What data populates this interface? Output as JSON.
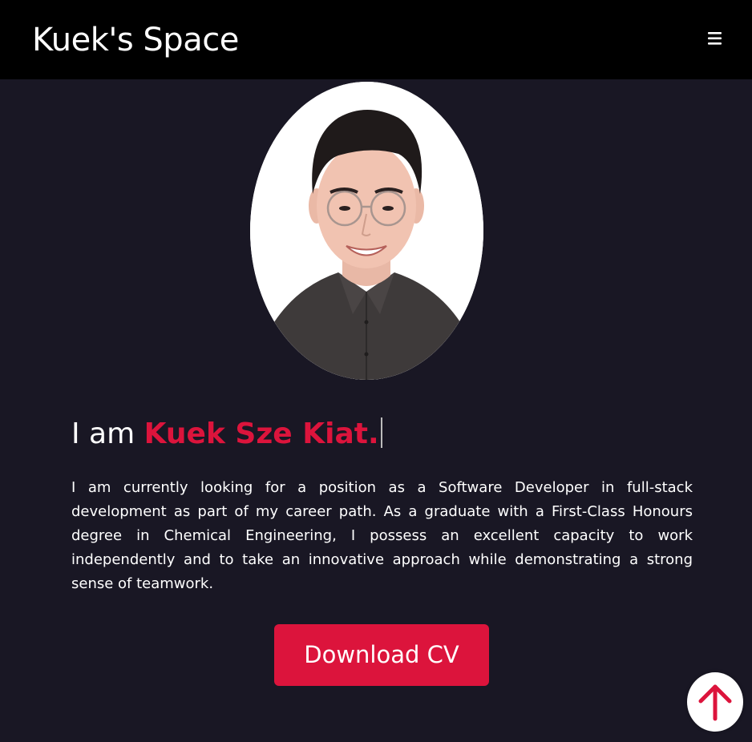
{
  "navbar": {
    "brand": "Kuek's Space",
    "menu_icon": "hamburger-menu-icon"
  },
  "profile": {
    "photo_alt": "Kuek Sze Kiat portrait"
  },
  "hero": {
    "intro": "I am ",
    "name": "Kuek Sze Kiat.",
    "bio": "I am currently looking for a position as a Software Developer in full-stack development as part of my career path. As a graduate with a First-Class Honours degree in Chemical Engineering, I possess an excellent capacity to work independently and to take an innovative approach while demonstrating a strong sense of teamwork.",
    "cv_button": "Download CV"
  },
  "scroll_top": {
    "icon": "arrow-up-icon"
  },
  "colors": {
    "accent": "#dc143c",
    "background": "#191724",
    "navbar": "#000000",
    "text": "#ffffff"
  }
}
